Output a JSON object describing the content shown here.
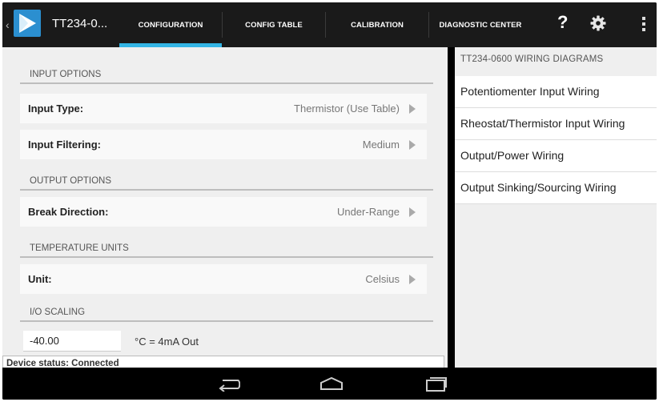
{
  "app": {
    "title": "TT234-0..."
  },
  "tabs": [
    {
      "label": "CONFIGURATION",
      "active": true
    },
    {
      "label": "CONFIG TABLE",
      "active": false
    },
    {
      "label": "CALIBRATION",
      "active": false
    },
    {
      "label": "DIAGNOSTIC CENTER",
      "active": false
    }
  ],
  "actions": {
    "help_label": "?",
    "settings_icon": "gear-icon",
    "overflow_icon": "overflow-menu-icon"
  },
  "sections": {
    "input": "INPUT OPTIONS",
    "output": "OUTPUT OPTIONS",
    "temperature": "TEMPERATURE UNITS",
    "scaling": "I/O SCALING"
  },
  "settings": {
    "input_type": {
      "label": "Input Type:",
      "value": "Thermistor (Use Table)"
    },
    "input_filtering": {
      "label": "Input Filtering:",
      "value": "Medium"
    },
    "break_direction": {
      "label": "Break Direction:",
      "value": "Under-Range"
    },
    "unit": {
      "label": "Unit:",
      "value": "Celsius"
    }
  },
  "scaling": {
    "value": "-40.00",
    "unit_label": "°C = 4mA Out"
  },
  "status": {
    "text": "Device status: Connected"
  },
  "wiring": {
    "heading": "TT234-0600 WIRING DIAGRAMS",
    "items": [
      "Potentiomenter Input Wiring",
      "Rheostat/Thermistor Input Wiring",
      "Output/Power Wiring",
      "Output Sinking/Sourcing Wiring"
    ]
  },
  "colors": {
    "accent": "#33b5e5",
    "logo": "#2b8fd0",
    "actionbar": "#1a1a1a"
  },
  "navbar": {
    "icons": [
      "back-icon",
      "home-icon",
      "recent-apps-icon"
    ]
  }
}
